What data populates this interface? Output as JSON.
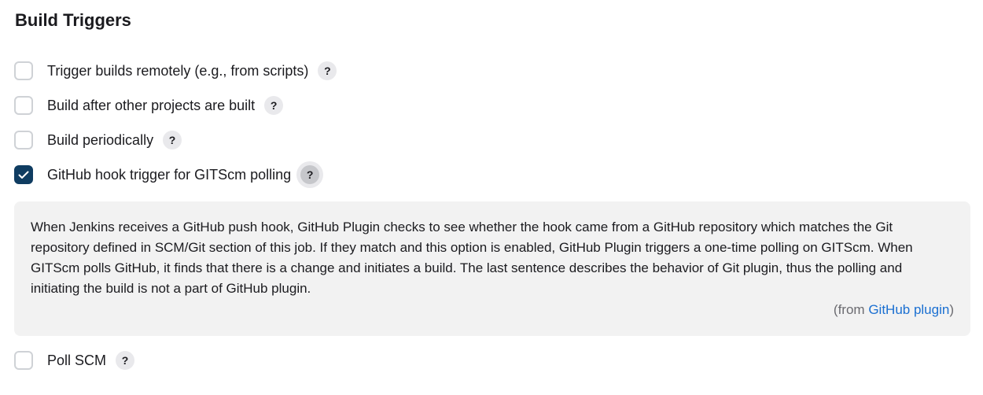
{
  "section": {
    "title": "Build Triggers"
  },
  "options": [
    {
      "label": "Trigger builds remotely (e.g., from scripts)",
      "checked": false,
      "help": "?"
    },
    {
      "label": "Build after other projects are built",
      "checked": false,
      "help": "?"
    },
    {
      "label": "Build periodically",
      "checked": false,
      "help": "?"
    },
    {
      "label": "GitHub hook trigger for GITScm polling",
      "checked": true,
      "help": "?"
    },
    {
      "label": "Poll SCM",
      "checked": false,
      "help": "?"
    }
  ],
  "help_panel": {
    "text": "When Jenkins receives a GitHub push hook, GitHub Plugin checks to see whether the hook came from a GitHub repository which matches the Git repository defined in SCM/Git section of this job. If they match and this option is enabled, GitHub Plugin triggers a one-time polling on GITScm. When GITScm polls GitHub, it finds that there is a change and initiates a build. The last sentence describes the behavior of Git plugin, thus the polling and initiating the build is not a part of GitHub plugin.",
    "from_prefix": "(from ",
    "from_link": "GitHub plugin",
    "from_suffix": ")"
  },
  "colors": {
    "checked_bg": "#0f3c61",
    "link": "#1a6fd1",
    "panel_bg": "#f2f2f2"
  },
  "icons": {
    "checkmark": "check-icon",
    "help": "help-icon"
  }
}
